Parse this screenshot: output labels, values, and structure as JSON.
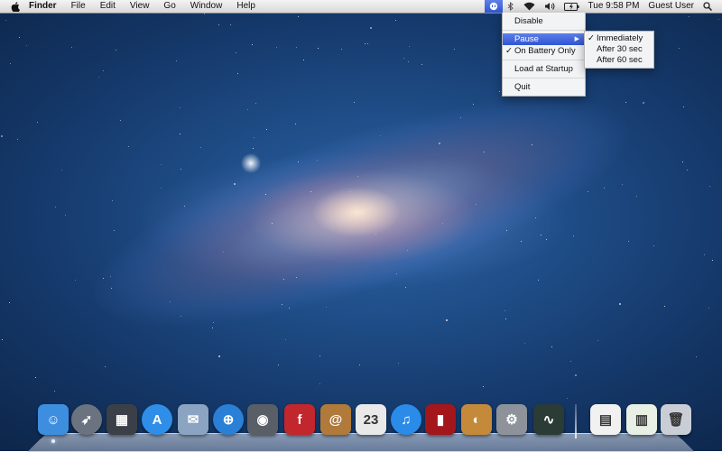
{
  "menubar": {
    "apple_icon": "apple-logo-icon",
    "app_name": "Finder",
    "menus": [
      "File",
      "Edit",
      "View",
      "Go",
      "Window",
      "Help"
    ],
    "status": {
      "utility_icon": "app-status-icon",
      "bluetooth_icon": "bluetooth-icon",
      "wifi_icon": "wifi-icon",
      "volume_icon": "volume-icon",
      "battery_icon": "battery-icon",
      "clock": "Tue 9:58 PM",
      "user": "Guest User",
      "spotlight_icon": "search-icon"
    }
  },
  "menu": {
    "items": [
      {
        "label": "Disable"
      },
      {
        "label": "Pause",
        "has_submenu": true,
        "highlighted": true
      },
      {
        "label": "On Battery Only",
        "checked": true
      },
      {
        "label": "Load at Startup"
      },
      {
        "label": "Quit"
      }
    ],
    "checkmark": "✓",
    "submenu_arrow": "▶"
  },
  "submenu": {
    "items": [
      {
        "label": "Immediately",
        "checked": true
      },
      {
        "label": "After 30 sec"
      },
      {
        "label": "After 60 sec"
      }
    ]
  },
  "dock": {
    "items": [
      {
        "name": "finder-icon",
        "glyph": "☺",
        "color": "#3e8ee0"
      },
      {
        "name": "launchpad-icon",
        "glyph": "➶",
        "color": "#6c7380"
      },
      {
        "name": "mission-control-icon",
        "glyph": "▦",
        "color": "#3a3f48"
      },
      {
        "name": "app-store-icon",
        "glyph": "A",
        "color": "#2f8ee8"
      },
      {
        "name": "mail-icon",
        "glyph": "✉",
        "color": "#8aa4c2"
      },
      {
        "name": "safari-icon",
        "glyph": "⊕",
        "color": "#2a7fd6"
      },
      {
        "name": "facetime-icon",
        "glyph": "◉",
        "color": "#5a5e66"
      },
      {
        "name": "flashcards-icon",
        "glyph": "f",
        "color": "#c1272d"
      },
      {
        "name": "address-book-icon",
        "glyph": "@",
        "color": "#b07a3a"
      },
      {
        "name": "calendar-icon",
        "glyph": "23",
        "color": "#e9e9e9"
      },
      {
        "name": "itunes-icon",
        "glyph": "♫",
        "color": "#2a8be8"
      },
      {
        "name": "photo-booth-icon",
        "glyph": "▮",
        "color": "#a3161b"
      },
      {
        "name": "iphoto-icon",
        "glyph": "◐",
        "color": "#c48a3a"
      },
      {
        "name": "system-preferences-icon",
        "glyph": "⚙",
        "color": "#8e939b"
      },
      {
        "name": "activity-monitor-icon",
        "glyph": "∿",
        "color": "#2b3b36"
      },
      {
        "name": "documents-stack-icon",
        "glyph": "▤",
        "color": "#f1f1f1"
      },
      {
        "name": "downloads-stack-icon",
        "glyph": "▥",
        "color": "#e8efe4"
      },
      {
        "name": "trash-icon",
        "glyph": "🗑",
        "color": "#c9ced6"
      }
    ]
  }
}
